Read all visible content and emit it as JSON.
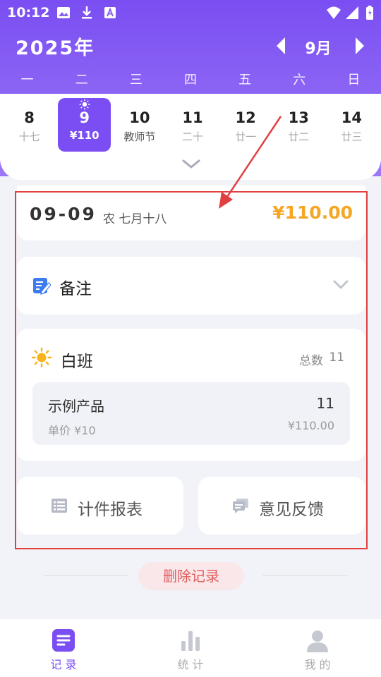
{
  "status_bar": {
    "time": "10:12"
  },
  "header": {
    "year": "2025年",
    "month": "9月",
    "weekdays": [
      "一",
      "二",
      "三",
      "四",
      "五",
      "六",
      "日"
    ]
  },
  "days": [
    {
      "num": "8",
      "sub": "十七"
    },
    {
      "num": "9",
      "sub": "¥110",
      "selected": true
    },
    {
      "num": "10",
      "sub": "教师节"
    },
    {
      "num": "11",
      "sub": "二十"
    },
    {
      "num": "12",
      "sub": "廿一"
    },
    {
      "num": "13",
      "sub": "廿二"
    },
    {
      "num": "14",
      "sub": "廿三"
    }
  ],
  "record": {
    "date": "09-09",
    "lunar": "农  七月十八",
    "total": "¥110.00"
  },
  "note": {
    "title": "备注"
  },
  "shift": {
    "title": "白班",
    "count_label": "总数",
    "count_value": "11",
    "product": {
      "name": "示例产品",
      "qty": "11",
      "unit_price": "单价 ¥10",
      "amount": "¥110.00"
    }
  },
  "actions": {
    "report": "计件报表",
    "feedback": "意见反馈"
  },
  "delete_label": "删除记录",
  "tabs": [
    {
      "label": "记 录",
      "icon": "record-icon",
      "active": true
    },
    {
      "label": "统 计",
      "icon": "stats-icon"
    },
    {
      "label": "我 的",
      "icon": "profile-icon"
    }
  ],
  "colors": {
    "accent": "#7a4ef2",
    "amount": "#f5a623",
    "delete": "#e25b5b",
    "annotation": "#e04040"
  }
}
